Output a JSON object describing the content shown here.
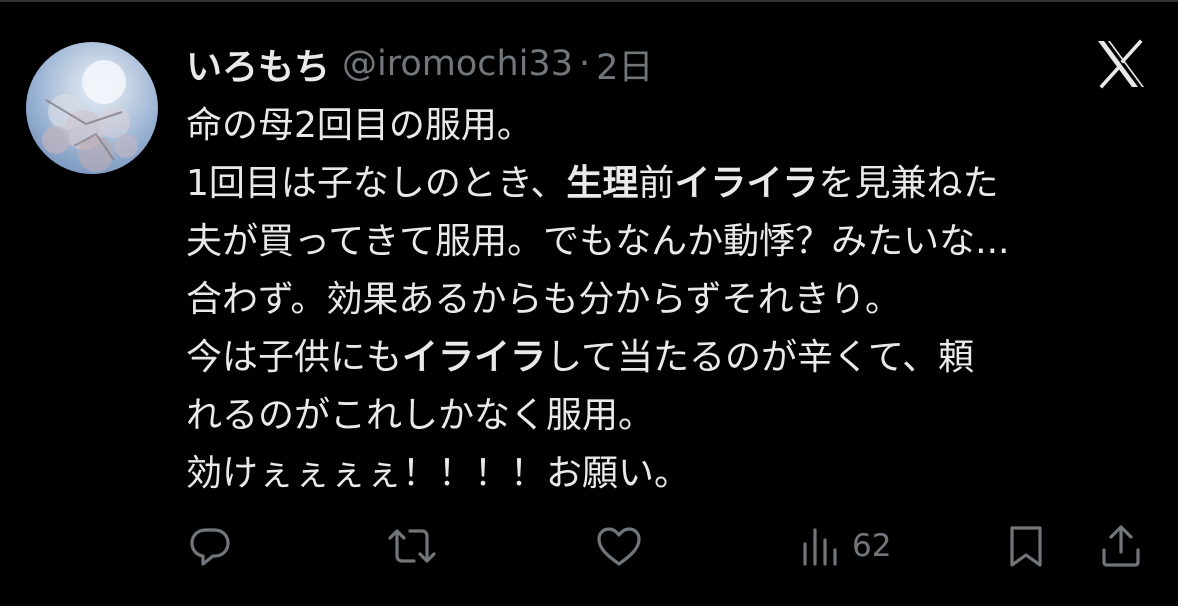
{
  "tweet": {
    "display_name": "いろもち",
    "handle": "@iromochi33",
    "separator": "·",
    "timestamp": "2日",
    "lines": [
      [
        {
          "text": "命の母2回目の服用。"
        }
      ],
      [
        {
          "text": "1回目は子なしのとき、"
        },
        {
          "text": "生理",
          "bold": true
        },
        {
          "text": "前"
        },
        {
          "text": "イライラ",
          "bold": true
        },
        {
          "text": "を見兼ねた"
        }
      ],
      [
        {
          "text": "夫が買ってきて服用。でもなんか動悸？みたいな..."
        }
      ],
      [
        {
          "text": "合わず。効果あるからも分からずそれきり。"
        }
      ],
      [
        {
          "text": "今は子供にも"
        },
        {
          "text": "イライラ",
          "bold": true
        },
        {
          "text": "して当たるのが辛くて、頼"
        }
      ],
      [
        {
          "text": "れるのがこれしかなく服用。"
        }
      ],
      [
        {
          "text": "効けぇぇぇぇ！！！！お願い。"
        }
      ]
    ]
  },
  "actions": {
    "views": "62"
  },
  "icons": {
    "avatar": "avatar-cherry-blossom",
    "platform": "x-logo-icon",
    "reply": "reply-icon",
    "retweet": "retweet-icon",
    "like": "heart-icon",
    "views": "views-icon",
    "bookmark": "bookmark-icon",
    "share": "share-icon"
  },
  "colors": {
    "background": "#000000",
    "text": "#e7e9ea",
    "secondary": "#71767b"
  }
}
